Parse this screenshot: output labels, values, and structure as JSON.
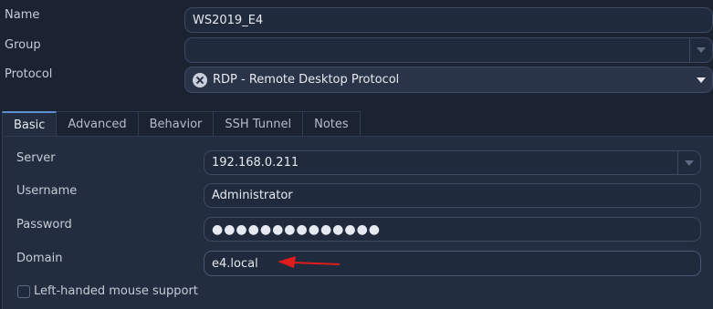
{
  "general": {
    "name_label": "Name",
    "name_value": "WS2019_E4",
    "group_label": "Group",
    "group_value": "",
    "protocol_label": "Protocol",
    "protocol_value": "RDP - Remote Desktop Protocol",
    "protocol_icon": "rdp-protocol-icon"
  },
  "tabs": [
    {
      "label": "Basic",
      "active": true
    },
    {
      "label": "Advanced",
      "active": false
    },
    {
      "label": "Behavior",
      "active": false
    },
    {
      "label": "SSH Tunnel",
      "active": false
    },
    {
      "label": "Notes",
      "active": false
    }
  ],
  "basic": {
    "server_label": "Server",
    "server_value": "192.168.0.211",
    "username_label": "Username",
    "username_value": "Administrator",
    "password_label": "Password",
    "password_value": "●●●●●●●●●●●●●●",
    "domain_label": "Domain",
    "domain_value": "e4.local",
    "left_handed_label": "Left-handed mouse support",
    "left_handed_checked": false
  },
  "colors": {
    "background": "#1b2231",
    "panel": "#232d40",
    "field": "#1f2a3d",
    "accent_tab": "#5b8fd0",
    "annotation_arrow": "#e01b1b"
  }
}
